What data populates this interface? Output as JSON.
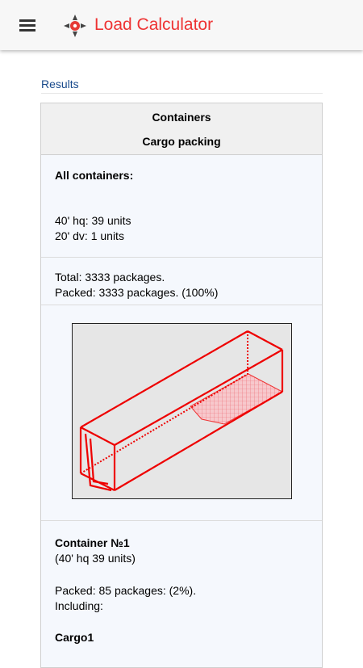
{
  "app": {
    "title": "Load Calculator",
    "accent_color": "#ee3333",
    "menu_icon": "menu-icon",
    "logo_icon": "compass-logo-icon"
  },
  "results_link": "Results",
  "panel": {
    "header_line1": "Containers",
    "header_line2": "Cargo packing",
    "all_containers_title": "All containers:",
    "containers": [
      "40' hq: 39 units",
      "20' dv: 1 units"
    ],
    "total": "Total: 3333 packages.",
    "packed": "Packed: 3333 packages. (100%)",
    "container1": {
      "title": "Container №1",
      "subtitle": "(40' hq 39 units)",
      "packed": "Packed: 85 packages: (2%).",
      "including": "Including:",
      "cargo_name": "Cargo1"
    }
  }
}
